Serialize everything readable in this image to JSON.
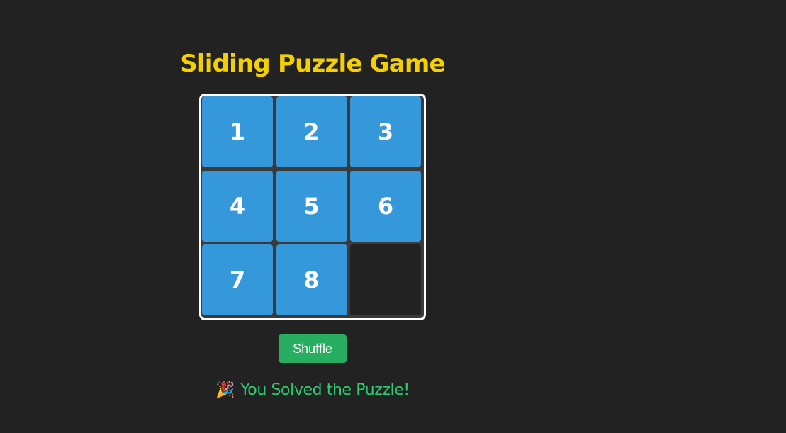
{
  "title": "Sliding Puzzle Game",
  "board": {
    "rows": 3,
    "cols": 3,
    "tiles": [
      "1",
      "2",
      "3",
      "4",
      "5",
      "6",
      "7",
      "8",
      ""
    ]
  },
  "controls": {
    "shuffle_label": "Shuffle"
  },
  "status": {
    "emoji": "🎉",
    "message": "You Solved the Puzzle!"
  },
  "colors": {
    "background": "#222222",
    "title": "#f5d000",
    "tile": "#3498db",
    "empty_tile": "#222222",
    "board_border": "#ffffff",
    "shuffle_button": "#27ae60",
    "message": "#2ecc71"
  }
}
